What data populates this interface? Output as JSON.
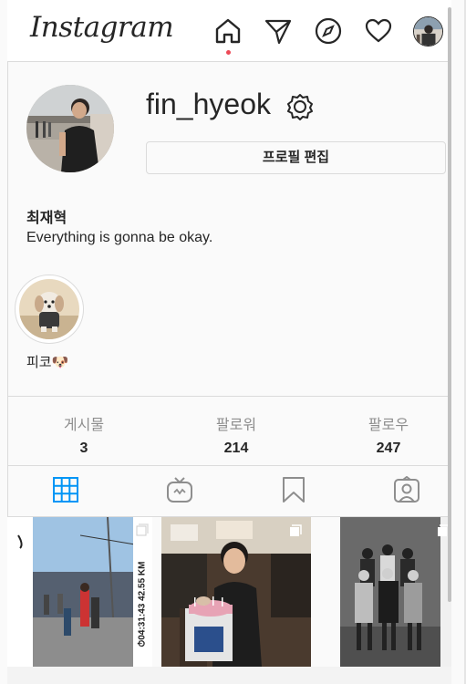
{
  "header": {
    "logo": "Instagram"
  },
  "profile": {
    "username": "fin_hyeok",
    "edit_button": "프로필 편집",
    "full_name": "최재혁",
    "bio": "Everything is gonna be okay."
  },
  "highlight": {
    "label": "피코🐶"
  },
  "stats": [
    {
      "label": "게시물",
      "value": "3"
    },
    {
      "label": "팔로워",
      "value": "214"
    },
    {
      "label": "팔로우",
      "value": "247"
    }
  ],
  "post1": {
    "watch_text": "⏱04:31:43  42.55 KM"
  },
  "colors": {
    "accent": "#0095f6",
    "notification": "#ed4956",
    "border": "#dbdbdb"
  },
  "icons": [
    "home-icon",
    "direct-icon",
    "explore-icon",
    "activity-icon",
    "avatar",
    "settings-icon",
    "grid-icon",
    "igtv-icon",
    "saved-icon",
    "tagged-icon"
  ]
}
